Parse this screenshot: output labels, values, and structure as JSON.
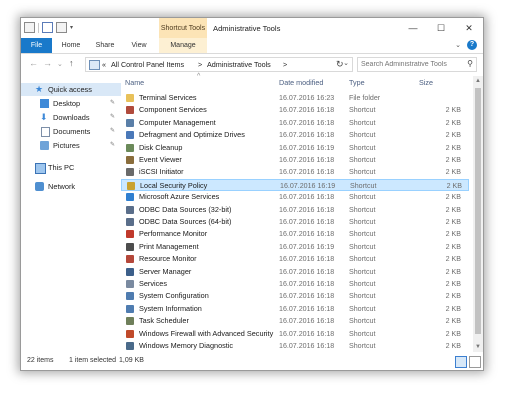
{
  "window": {
    "title": "Administrative Tools",
    "contextual_tab": "Shortcut Tools",
    "controls": {
      "minimize": "—",
      "maximize": "☐",
      "close": "✕"
    }
  },
  "ribbon": {
    "tabs": [
      {
        "label": "File",
        "name": "tab-file"
      },
      {
        "label": "Home",
        "name": "tab-home"
      },
      {
        "label": "Share",
        "name": "tab-share"
      },
      {
        "label": "View",
        "name": "tab-view"
      },
      {
        "label": "Manage",
        "name": "tab-manage"
      }
    ],
    "help": "?",
    "collapse": "⌄"
  },
  "navigation": {
    "back": "←",
    "forward": "→",
    "recent": "⌄",
    "up": "↑",
    "breadcrumb": {
      "overflow": "«",
      "items": [
        "All Control Panel Items",
        "Administrative Tools"
      ],
      "separator": ">"
    },
    "address_dropdown": "⌄",
    "refresh": "↻",
    "search_placeholder": "Search Administrative Tools",
    "search_icon": "⚲"
  },
  "sidebar": {
    "items": [
      {
        "label": "Quick access",
        "icon": "star-icon",
        "pinned": false,
        "selected": true
      },
      {
        "label": "Desktop",
        "icon": "desktop-icon",
        "pinned": true
      },
      {
        "label": "Downloads",
        "icon": "download-icon",
        "pinned": true
      },
      {
        "label": "Documents",
        "icon": "documents-icon",
        "pinned": true
      },
      {
        "label": "Pictures",
        "icon": "pictures-icon",
        "pinned": true
      },
      {
        "label": "This PC",
        "icon": "pc-icon",
        "pinned": false
      },
      {
        "label": "Network",
        "icon": "network-icon",
        "pinned": false
      }
    ],
    "pin_glyph": "✎"
  },
  "columns": {
    "name": "Name",
    "date": "Date modified",
    "type": "Type",
    "size": "Size",
    "sort_caret": "^"
  },
  "files": [
    {
      "name": "Terminal Services",
      "date": "16.07.2016 16:23",
      "type": "File folder",
      "size": "",
      "color": "#e8c15a"
    },
    {
      "name": "Component Services",
      "date": "16.07.2016 16:18",
      "type": "Shortcut",
      "size": "2 KB",
      "color": "#b04a3c"
    },
    {
      "name": "Computer Management",
      "date": "16.07.2016 16:18",
      "type": "Shortcut",
      "size": "2 KB",
      "color": "#5a7fa8"
    },
    {
      "name": "Defragment and Optimize Drives",
      "date": "16.07.2016 16:18",
      "type": "Shortcut",
      "size": "2 KB",
      "color": "#4a78b8"
    },
    {
      "name": "Disk Cleanup",
      "date": "16.07.2016 16:19",
      "type": "Shortcut",
      "size": "2 KB",
      "color": "#6b8a5a"
    },
    {
      "name": "Event Viewer",
      "date": "16.07.2016 16:18",
      "type": "Shortcut",
      "size": "2 KB",
      "color": "#8a6d3c"
    },
    {
      "name": "iSCSI Initiator",
      "date": "16.07.2016 16:18",
      "type": "Shortcut",
      "size": "2 KB",
      "color": "#6a6a6a"
    },
    {
      "name": "Local Security Policy",
      "date": "16.07.2016 16:19",
      "type": "Shortcut",
      "size": "2 KB",
      "color": "#c9a230",
      "selected": true
    },
    {
      "name": "Microsoft Azure Services",
      "date": "16.07.2016 16:18",
      "type": "Shortcut",
      "size": "2 KB",
      "color": "#2f7fd0"
    },
    {
      "name": "ODBC Data Sources (32-bit)",
      "date": "16.07.2016 16:18",
      "type": "Shortcut",
      "size": "2 KB",
      "color": "#5a6e8a"
    },
    {
      "name": "ODBC Data Sources (64-bit)",
      "date": "16.07.2016 16:18",
      "type": "Shortcut",
      "size": "2 KB",
      "color": "#5a6e8a"
    },
    {
      "name": "Performance Monitor",
      "date": "16.07.2016 16:18",
      "type": "Shortcut",
      "size": "2 KB",
      "color": "#c0392b"
    },
    {
      "name": "Print Management",
      "date": "16.07.2016 16:19",
      "type": "Shortcut",
      "size": "2 KB",
      "color": "#4d4d4d"
    },
    {
      "name": "Resource Monitor",
      "date": "16.07.2016 16:18",
      "type": "Shortcut",
      "size": "2 KB",
      "color": "#b4473a"
    },
    {
      "name": "Server Manager",
      "date": "16.07.2016 16:18",
      "type": "Shortcut",
      "size": "2 KB",
      "color": "#3c5f8a"
    },
    {
      "name": "Services",
      "date": "16.07.2016 16:18",
      "type": "Shortcut",
      "size": "2 KB",
      "color": "#7a8aa0"
    },
    {
      "name": "System Configuration",
      "date": "16.07.2016 16:18",
      "type": "Shortcut",
      "size": "2 KB",
      "color": "#4f7cb0"
    },
    {
      "name": "System Information",
      "date": "16.07.2016 16:18",
      "type": "Shortcut",
      "size": "2 KB",
      "color": "#4f7cb0"
    },
    {
      "name": "Task Scheduler",
      "date": "16.07.2016 16:18",
      "type": "Shortcut",
      "size": "2 KB",
      "color": "#6f7f5a"
    },
    {
      "name": "Windows Firewall with Advanced Security",
      "date": "16.07.2016 16:18",
      "type": "Shortcut",
      "size": "2 KB",
      "color": "#c04a2a"
    },
    {
      "name": "Windows Memory Diagnostic",
      "date": "16.07.2016 16:18",
      "type": "Shortcut",
      "size": "2 KB",
      "color": "#4a6a8a"
    }
  ],
  "status": {
    "items": "22 items",
    "selection": "1 item selected",
    "size": "1,09 KB"
  },
  "scrollbar": {
    "up": "▲",
    "down": "▼"
  },
  "colors": {
    "accent": "#1979ca",
    "context_tab": "#fce4b6",
    "selection": "#cce8ff"
  }
}
